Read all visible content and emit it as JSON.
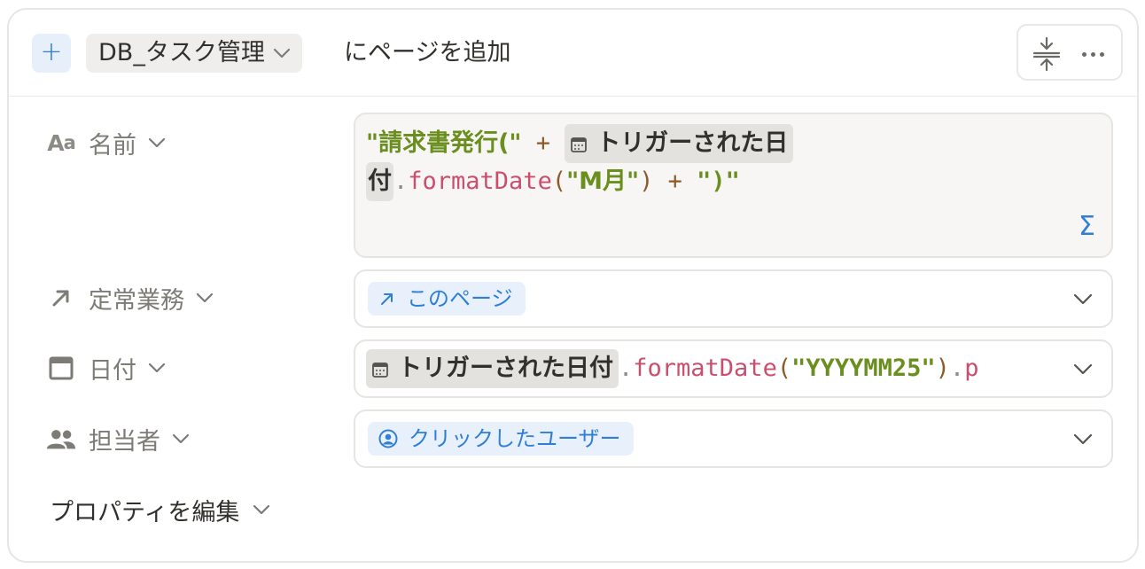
{
  "header": {
    "plus_icon": "plus-icon",
    "database_name": "DB_タスク管理",
    "action_text": "にページを追加",
    "toolbar": {
      "collapse_icon": "collapse-vertical-icon",
      "more_icon": "more-horizontal-icon"
    }
  },
  "properties": [
    {
      "id": "name",
      "icon": "text-aa-icon",
      "icon_text": "Aa",
      "label": "名前",
      "type": "formula",
      "formula": {
        "str1": "\"請求書発行(\"",
        "op1": "+",
        "token1": "トリガーされた日",
        "token1_cont": "付",
        "dot": ".",
        "fn": "formatDate",
        "paren_open": "(",
        "arg": "\"M月\"",
        "paren_close": ")",
        "op2": "+",
        "str2": "\")\""
      },
      "sigma": "Σ"
    },
    {
      "id": "routine",
      "icon": "arrow-up-right-icon",
      "label": "定常業務",
      "type": "relation",
      "value": "このページ"
    },
    {
      "id": "date",
      "icon": "calendar-icon",
      "label": "日付",
      "type": "formula",
      "formula": {
        "token": "トリガーされた日付",
        "dot": ".",
        "fn": "formatDate",
        "paren_open": "(",
        "arg": "\"YYYYMM25\"",
        "paren_close": ")",
        "dot2": ".",
        "trail": "p"
      }
    },
    {
      "id": "assignee",
      "icon": "people-icon",
      "label": "担当者",
      "type": "person",
      "value": "クリックしたユーザー"
    }
  ],
  "edit_properties_label": "プロパティを編集",
  "colors": {
    "accent": "#2f7ed8",
    "string": "#6a8f1f",
    "function": "#c94f6d",
    "token_bg": "#e3e2df"
  }
}
